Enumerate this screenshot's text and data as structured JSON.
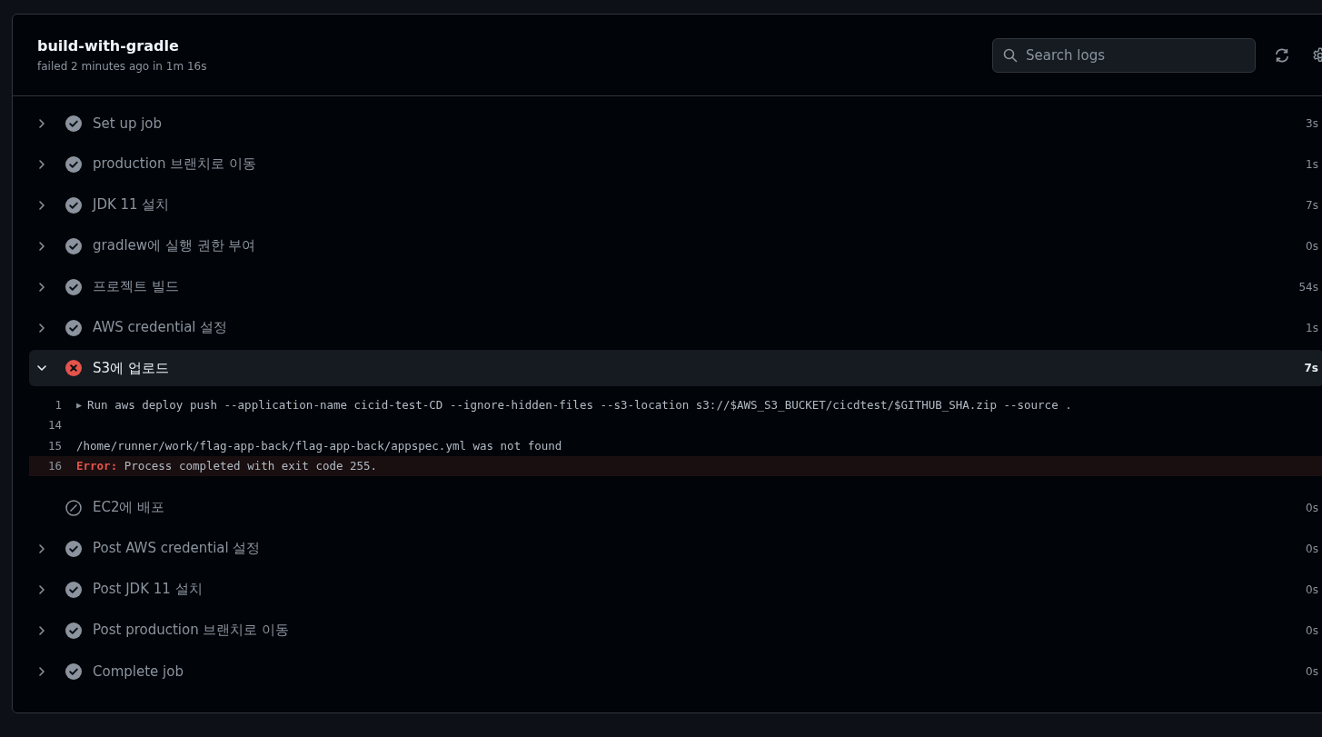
{
  "job": {
    "title": "build-with-gradle",
    "subtitle": "failed 2 minutes ago in 1m 16s"
  },
  "search": {
    "placeholder": "Search logs"
  },
  "steps": [
    {
      "name": "Set up job",
      "kind": "success",
      "expanded": false,
      "duration": "3s"
    },
    {
      "name": "production 브랜치로 이동",
      "kind": "success",
      "expanded": false,
      "duration": "1s"
    },
    {
      "name": "JDK 11 설치",
      "kind": "success",
      "expanded": false,
      "duration": "7s"
    },
    {
      "name": "gradlew에 실행 권한 부여",
      "kind": "success",
      "expanded": false,
      "duration": "0s"
    },
    {
      "name": "프로젝트 빌드",
      "kind": "success",
      "expanded": false,
      "duration": "54s"
    },
    {
      "name": "AWS credential 설정",
      "kind": "success",
      "expanded": false,
      "duration": "1s"
    },
    {
      "name": "S3에 업로드",
      "kind": "failure",
      "expanded": true,
      "duration": "7s",
      "log": [
        {
          "number": "1",
          "kind": "group",
          "toggle": "▶",
          "text": "Run aws deploy push --application-name cicid-test-CD --ignore-hidden-files --s3-location s3://$AWS_S3_BUCKET/cicdtest/$GITHUB_SHA.zip --source ."
        },
        {
          "number": "14",
          "kind": "plain"
        },
        {
          "number": "15",
          "kind": "plain",
          "text": "/home/runner/work/flag-app-back/flag-app-back/appspec.yml was not found"
        },
        {
          "number": "16",
          "kind": "error",
          "prefix": "Error:",
          "text": "Process completed with exit code 255."
        }
      ]
    },
    {
      "name": "EC2에 배포",
      "kind": "skipped",
      "expanded": false,
      "duration": "0s"
    },
    {
      "name": "Post AWS credential 설정",
      "kind": "success",
      "expanded": false,
      "duration": "0s"
    },
    {
      "name": "Post JDK 11 설치",
      "kind": "success",
      "expanded": false,
      "duration": "0s"
    },
    {
      "name": "Post production 브랜치로 이동",
      "kind": "success",
      "expanded": false,
      "duration": "0s"
    },
    {
      "name": "Complete job",
      "kind": "success",
      "expanded": false,
      "duration": "0s"
    }
  ]
}
